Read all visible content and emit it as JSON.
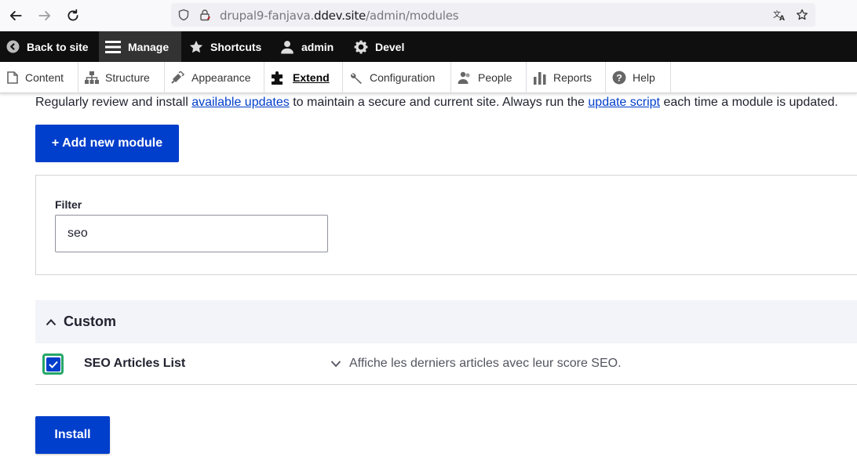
{
  "browser": {
    "url_prefix": "drupal9-fanjava.",
    "url_host": "ddev.site",
    "url_path": "/admin/modules"
  },
  "toolbar": {
    "back_to_site": "Back to site",
    "manage": "Manage",
    "shortcuts": "Shortcuts",
    "user": "admin",
    "devel": "Devel"
  },
  "tray": {
    "items": [
      "Content",
      "Structure",
      "Appearance",
      "Extend",
      "Configuration",
      "People",
      "Reports",
      "Help"
    ],
    "active": "Extend"
  },
  "help": {
    "text_1": "Regularly review and install ",
    "link_1": "available updates",
    "text_2": " to maintain a secure and current site. Always run the ",
    "link_2": "update script",
    "text_3": " each time a module is updated."
  },
  "add_module_button": "+ Add new module",
  "filter": {
    "label": "Filter",
    "value": "seo"
  },
  "group": {
    "title": "Custom",
    "modules": [
      {
        "name": "SEO Articles List",
        "description": "Affiche les derniers articles avec leur score SEO.",
        "checked": true
      }
    ]
  },
  "install_button": "Install",
  "colors": {
    "primary": "#003ecc",
    "toolbar_bg": "#0f0f0f",
    "focus_green": "#26a769"
  }
}
